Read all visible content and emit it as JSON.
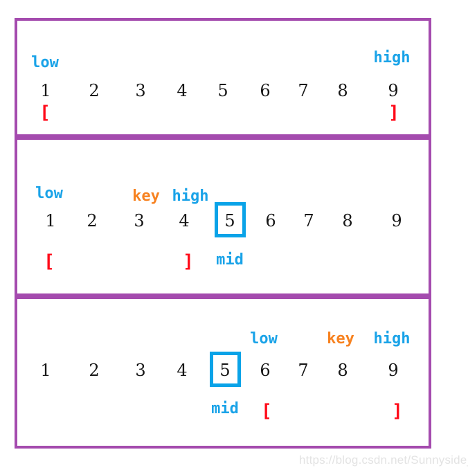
{
  "figure": {
    "title_visible": false,
    "watermark": "https://blog.csdn.net/Sunnyside_",
    "colors": {
      "panel_border": "#a44bae",
      "marker_blue": "#1aa3e8",
      "marker_orange": "#f78220",
      "bracket_red": "#ff0a18",
      "number": "#161616",
      "highlight_box": "#0aa3e8",
      "background": "#ffffff",
      "watermark": "#e3e3e3"
    }
  },
  "array": {
    "values": [
      "1",
      "2",
      "3",
      "4",
      "5",
      "6",
      "7",
      "8",
      "9"
    ]
  },
  "steps": [
    {
      "id": "step-1",
      "numbers": [
        "1",
        "2",
        "3",
        "4",
        "5",
        "6",
        "7",
        "8",
        "9"
      ],
      "markers": [
        {
          "label": "low",
          "kind": "low",
          "index": 0
        },
        {
          "label": "high",
          "kind": "high",
          "index": 8
        }
      ],
      "brackets": [
        {
          "label": "[",
          "index": 0
        },
        {
          "label": "]",
          "index": 8
        }
      ],
      "mid_label": null,
      "mid_index": null,
      "highlight_index": null
    },
    {
      "id": "step-2",
      "numbers": [
        "1",
        "2",
        "3",
        "4",
        "5",
        "6",
        "7",
        "8",
        "9"
      ],
      "markers": [
        {
          "label": "low",
          "kind": "low",
          "index": 0
        },
        {
          "label": "key",
          "kind": "key",
          "index": 2
        },
        {
          "label": "high",
          "kind": "high",
          "index": 3
        }
      ],
      "brackets": [
        {
          "label": "[",
          "index": 0
        },
        {
          "label": "]",
          "index": 3
        }
      ],
      "mid_label": "mid",
      "mid_index": 4,
      "highlight_index": 4
    },
    {
      "id": "step-3",
      "numbers": [
        "1",
        "2",
        "3",
        "4",
        "5",
        "6",
        "7",
        "8",
        "9"
      ],
      "markers": [
        {
          "label": "low",
          "kind": "low",
          "index": 5
        },
        {
          "label": "key",
          "kind": "key",
          "index": 7
        },
        {
          "label": "high",
          "kind": "high",
          "index": 8
        }
      ],
      "brackets": [
        {
          "label": "[",
          "index": 5
        },
        {
          "label": "]",
          "index": 8
        }
      ],
      "mid_label": "mid",
      "mid_index": 4,
      "highlight_index": 4
    }
  ]
}
